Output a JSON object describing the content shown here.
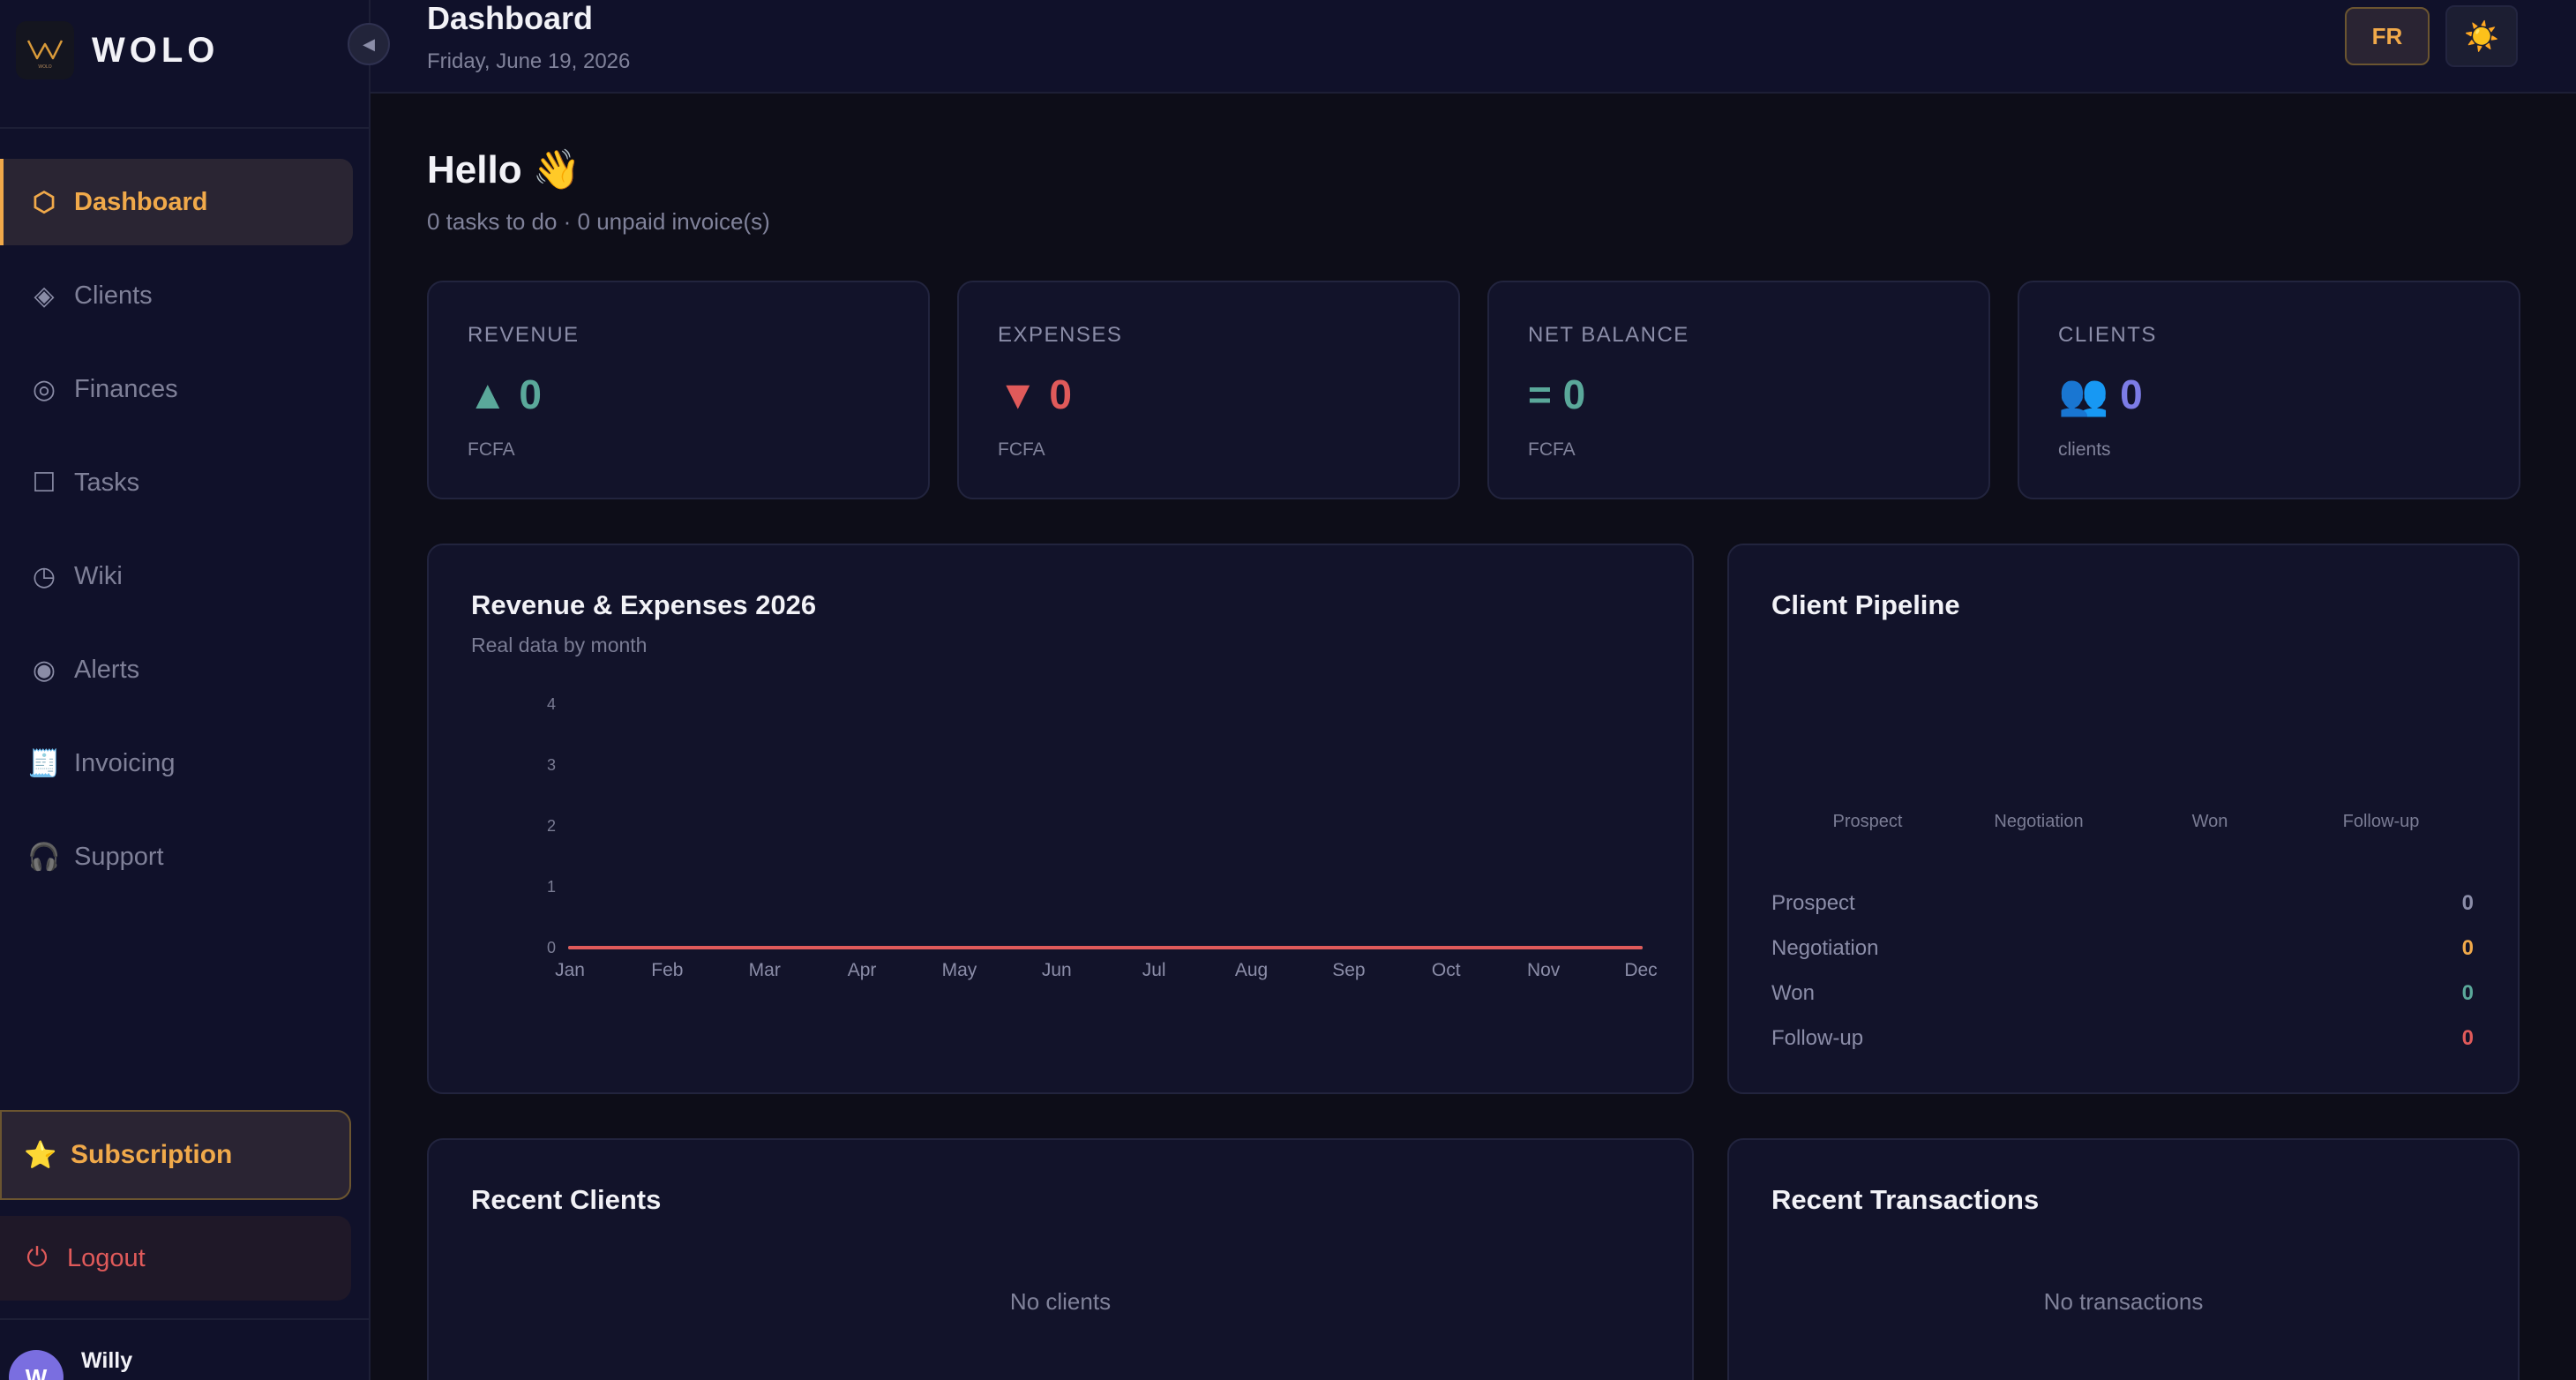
{
  "brand": {
    "name": "WOLO",
    "logo_caption": "WOLO"
  },
  "sidebar": {
    "items": [
      {
        "label": "Dashboard",
        "icon": "hexagon-icon",
        "glyph": "⬡",
        "active": true
      },
      {
        "label": "Clients",
        "icon": "diamond-icon",
        "glyph": "◈",
        "active": false
      },
      {
        "label": "Finances",
        "icon": "ring-icon",
        "glyph": "◎",
        "active": false
      },
      {
        "label": "Tasks",
        "icon": "checkbox-icon",
        "glyph": "☐",
        "active": false
      },
      {
        "label": "Wiki",
        "icon": "clock-icon",
        "glyph": "◷",
        "active": false
      },
      {
        "label": "Alerts",
        "icon": "target-icon",
        "glyph": "◉",
        "active": false
      },
      {
        "label": "Invoicing",
        "icon": "receipt-icon",
        "glyph": "🧾",
        "active": false
      },
      {
        "label": "Support",
        "icon": "headphones-icon",
        "glyph": "🎧",
        "active": false
      }
    ],
    "subscription": {
      "label": "Subscription",
      "glyph": "⭐"
    },
    "logout": {
      "label": "Logout",
      "glyph": "⏻"
    },
    "user": {
      "initial": "W",
      "name": "Willy"
    }
  },
  "header": {
    "title": "Dashboard",
    "date": "Friday, June 19, 2026",
    "lang_label": "FR",
    "theme_glyph": "☀️"
  },
  "greeting": {
    "title": "Hello 👋",
    "subtitle": "0 tasks to do · 0 unpaid invoice(s)"
  },
  "stats": {
    "revenue": {
      "label": "REVENUE",
      "glyph": "▲",
      "value": "0",
      "unit": "FCFA",
      "color": "#5aa89a"
    },
    "expenses": {
      "label": "EXPENSES",
      "glyph": "▼",
      "value": "0",
      "unit": "FCFA",
      "color": "#e05a5a"
    },
    "net_balance": {
      "label": "NET BALANCE",
      "glyph": "=",
      "value": "0",
      "unit": "FCFA",
      "color": "#5aa89a"
    },
    "clients": {
      "label": "CLIENTS",
      "glyph": "👥",
      "value": "0",
      "unit": "clients",
      "color": "#7c7ce6"
    }
  },
  "revenue_chart": {
    "title": "Revenue & Expenses 2026",
    "subtitle": "Real data by month"
  },
  "chart_data": {
    "type": "line",
    "title": "Revenue & Expenses 2026",
    "subtitle": "Real data by month",
    "categories": [
      "Jan",
      "Feb",
      "Mar",
      "Apr",
      "May",
      "Jun",
      "Jul",
      "Aug",
      "Sep",
      "Oct",
      "Nov",
      "Dec"
    ],
    "series": [
      {
        "values": [
          0,
          0,
          0,
          0,
          0,
          0,
          0,
          0,
          0,
          0,
          0,
          0
        ],
        "color": "#5aa89a"
      },
      {
        "values": [
          0,
          0,
          0,
          0,
          0,
          0,
          0,
          0,
          0,
          0,
          0,
          0
        ],
        "color": "#e05a5a"
      }
    ],
    "yticks": [
      "0",
      "1",
      "2",
      "3",
      "4"
    ],
    "ylim": [
      0,
      4
    ],
    "grid": false
  },
  "pipeline": {
    "title": "Client Pipeline",
    "columns": [
      "Prospect",
      "Negotiation",
      "Won",
      "Follow-up"
    ],
    "rows": [
      {
        "label": "Prospect",
        "value": "0",
        "color": "#8b8da8"
      },
      {
        "label": "Negotiation",
        "value": "0",
        "color": "#f0a94a"
      },
      {
        "label": "Won",
        "value": "0",
        "color": "#5aa89a"
      },
      {
        "label": "Follow-up",
        "value": "0",
        "color": "#e05a5a"
      }
    ]
  },
  "recent_clients": {
    "title": "Recent Clients",
    "empty": "No clients"
  },
  "recent_transactions": {
    "title": "Recent Transactions",
    "empty": "No transactions"
  }
}
